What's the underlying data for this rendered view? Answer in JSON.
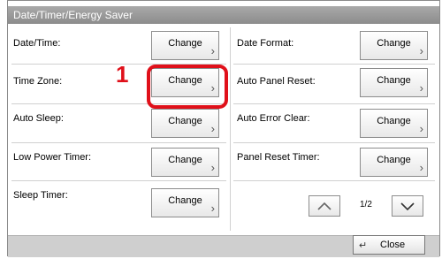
{
  "window": {
    "title": "Date/Timer/Energy Saver"
  },
  "annotation": {
    "marker": "1"
  },
  "left_column": [
    {
      "label": "Date/Time:",
      "button": "Change"
    },
    {
      "label": "Time Zone:",
      "button": "Change"
    },
    {
      "label": "Auto Sleep:",
      "button": "Change"
    },
    {
      "label": "Low Power Timer:",
      "button": "Change"
    },
    {
      "label": "Sleep Timer:",
      "button": "Change"
    }
  ],
  "right_column": [
    {
      "label": "Date Format:",
      "button": "Change"
    },
    {
      "label": "Auto Panel Reset:",
      "button": "Change"
    },
    {
      "label": "Auto Error Clear:",
      "button": "Change"
    },
    {
      "label": "Panel Reset Timer:",
      "button": "Change"
    }
  ],
  "pagination": {
    "page": "1/2"
  },
  "footer": {
    "close_label": "Close"
  },
  "colors": {
    "highlight": "#e0101a",
    "titlebar": "#9a9a9a"
  },
  "icons": {
    "chevron": "chevron-right-icon",
    "up": "arrow-up-icon",
    "down": "arrow-down-icon",
    "enter": "enter-icon"
  }
}
